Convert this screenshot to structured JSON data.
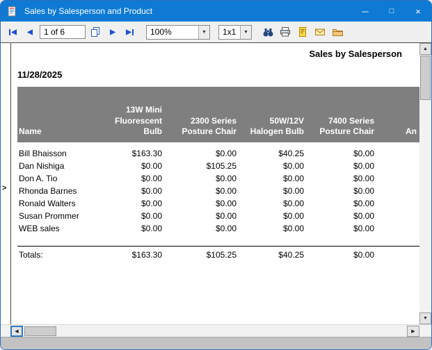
{
  "window": {
    "title": "Sales by Salesperson and Product"
  },
  "window_controls": {
    "minimize": "─",
    "maximize": "□",
    "close": "×"
  },
  "toolbar": {
    "page_field": "1 of 6",
    "zoom_value": "100%",
    "layout_value": "1x1",
    "icons": {
      "first_page": "◀",
      "prev_page": "◀",
      "next_page": "▶",
      "last_page": "▶",
      "combo_arrow": "▼"
    }
  },
  "scrollbars": {
    "up": "▲",
    "down": "▼",
    "left": "◀",
    "right": "▶"
  },
  "group_toggle": ">",
  "report": {
    "title": "Sales by Salesperson",
    "date": "11/28/2025",
    "columns": [
      "Name",
      "13W Mini Fluorescent Bulb",
      "2300 Series Posture Chair",
      "50W/12V Halogen Bulb",
      "7400 Series Posture Chair",
      "An"
    ],
    "rows": [
      {
        "name": "Bill Bhaisson",
        "values": [
          "$163.30",
          "$0.00",
          "$40.25",
          "$0.00"
        ]
      },
      {
        "name": "Dan Nishiga",
        "values": [
          "$0.00",
          "$105.25",
          "$0.00",
          "$0.00"
        ]
      },
      {
        "name": "Don A. Tio",
        "values": [
          "$0.00",
          "$0.00",
          "$0.00",
          "$0.00"
        ]
      },
      {
        "name": "Rhonda Barnes",
        "values": [
          "$0.00",
          "$0.00",
          "$0.00",
          "$0.00"
        ]
      },
      {
        "name": "Ronald Walters",
        "values": [
          "$0.00",
          "$0.00",
          "$0.00",
          "$0.00"
        ]
      },
      {
        "name": "Susan Prommer",
        "values": [
          "$0.00",
          "$0.00",
          "$0.00",
          "$0.00"
        ]
      },
      {
        "name": "WEB sales",
        "values": [
          "$0.00",
          "$0.00",
          "$0.00",
          "$0.00"
        ]
      }
    ],
    "totals": {
      "label": "Totals:",
      "values": [
        "$163.30",
        "$105.25",
        "$40.25",
        "$0.00"
      ]
    }
  },
  "colors": {
    "titlebar": "#0e7ad3",
    "header_band": "#7f7f7f",
    "nav_arrow": "#1d50d0"
  }
}
